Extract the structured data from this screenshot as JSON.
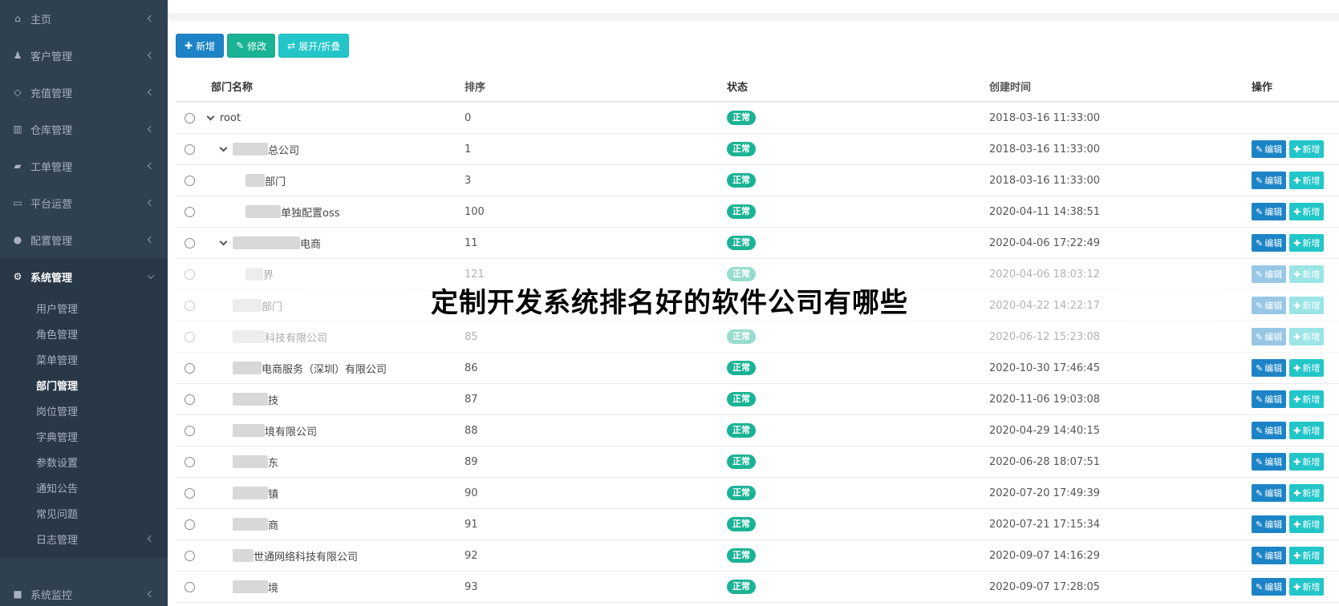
{
  "sidebar": {
    "items": [
      {
        "label": "主页",
        "icon": "home-icon",
        "glyph": "⌂"
      },
      {
        "label": "客户管理",
        "icon": "user-icon",
        "glyph": "♟"
      },
      {
        "label": "充值管理",
        "icon": "diamond-icon",
        "glyph": "◇"
      },
      {
        "label": "仓库管理",
        "icon": "bank-icon",
        "glyph": "▥"
      },
      {
        "label": "工单管理",
        "icon": "book-icon",
        "glyph": "▰"
      },
      {
        "label": "平台运营",
        "icon": "desktop-icon",
        "glyph": "▭"
      },
      {
        "label": "配置管理",
        "icon": "circle-icon",
        "glyph": "●"
      },
      {
        "label": "系统管理",
        "icon": "gear-icon",
        "glyph": "⚙"
      }
    ],
    "subitems": [
      "用户管理",
      "角色管理",
      "菜单管理",
      "部门管理",
      "岗位管理",
      "字典管理",
      "参数设置",
      "通知公告",
      "常见问题",
      "日志管理"
    ],
    "bottom_item": {
      "label": "系统监控",
      "icon": "video-icon",
      "glyph": "■"
    }
  },
  "toolbar": {
    "add_label": "新增",
    "edit_label": "修改",
    "toggle_label": "展开/折叠"
  },
  "table": {
    "headers": {
      "name": "部门名称",
      "sort": "排序",
      "status": "状态",
      "created": "创建时间",
      "ops": "操作"
    },
    "edit_label": "编辑",
    "add_label": "新增",
    "rows": [
      {
        "name": "root",
        "sort": "0",
        "status": "正常",
        "created": "2018-03-16 11:33:00"
      },
      {
        "name": "总公司",
        "sort": "1",
        "status": "正常",
        "created": "2018-03-16 11:33:00"
      },
      {
        "name": "部门",
        "sort": "3",
        "status": "正常",
        "created": "2018-03-16 11:33:00"
      },
      {
        "name": "单独配置oss",
        "sort": "100",
        "status": "正常",
        "created": "2020-04-11 14:38:51"
      },
      {
        "name": "电商",
        "sort": "11",
        "status": "正常",
        "created": "2020-04-06 17:22:49"
      },
      {
        "name": "界",
        "sort": "121",
        "status": "正常",
        "created": "2020-04-06 18:03:12"
      },
      {
        "name": "部门",
        "sort": "",
        "status": "",
        "created": "2020-04-22 14:22:17"
      },
      {
        "name": "科技有限公司",
        "sort": "85",
        "status": "正常",
        "created": "2020-06-12 15:23:08"
      },
      {
        "name": "电商服务（深圳）有限公司",
        "sort": "86",
        "status": "正常",
        "created": "2020-10-30 17:46:45"
      },
      {
        "name": "技",
        "sort": "87",
        "status": "正常",
        "created": "2020-11-06 19:03:08"
      },
      {
        "name": "境有限公司",
        "sort": "88",
        "status": "正常",
        "created": "2020-04-29 14:40:15"
      },
      {
        "name": "东",
        "sort": "89",
        "status": "正常",
        "created": "2020-06-28 18:07:51"
      },
      {
        "name": "镇",
        "sort": "90",
        "status": "正常",
        "created": "2020-07-20 17:49:39"
      },
      {
        "name": "商",
        "sort": "91",
        "status": "正常",
        "created": "2020-07-21 17:15:34"
      },
      {
        "name": "世通网络科技有限公司",
        "sort": "92",
        "status": "正常",
        "created": "2020-09-07 14:16:29"
      },
      {
        "name": "境",
        "sort": "93",
        "status": "正常",
        "created": "2020-09-07 17:28:05"
      }
    ]
  },
  "overlay": {
    "title": "定制开发系统排名好的软件公司有哪些"
  }
}
